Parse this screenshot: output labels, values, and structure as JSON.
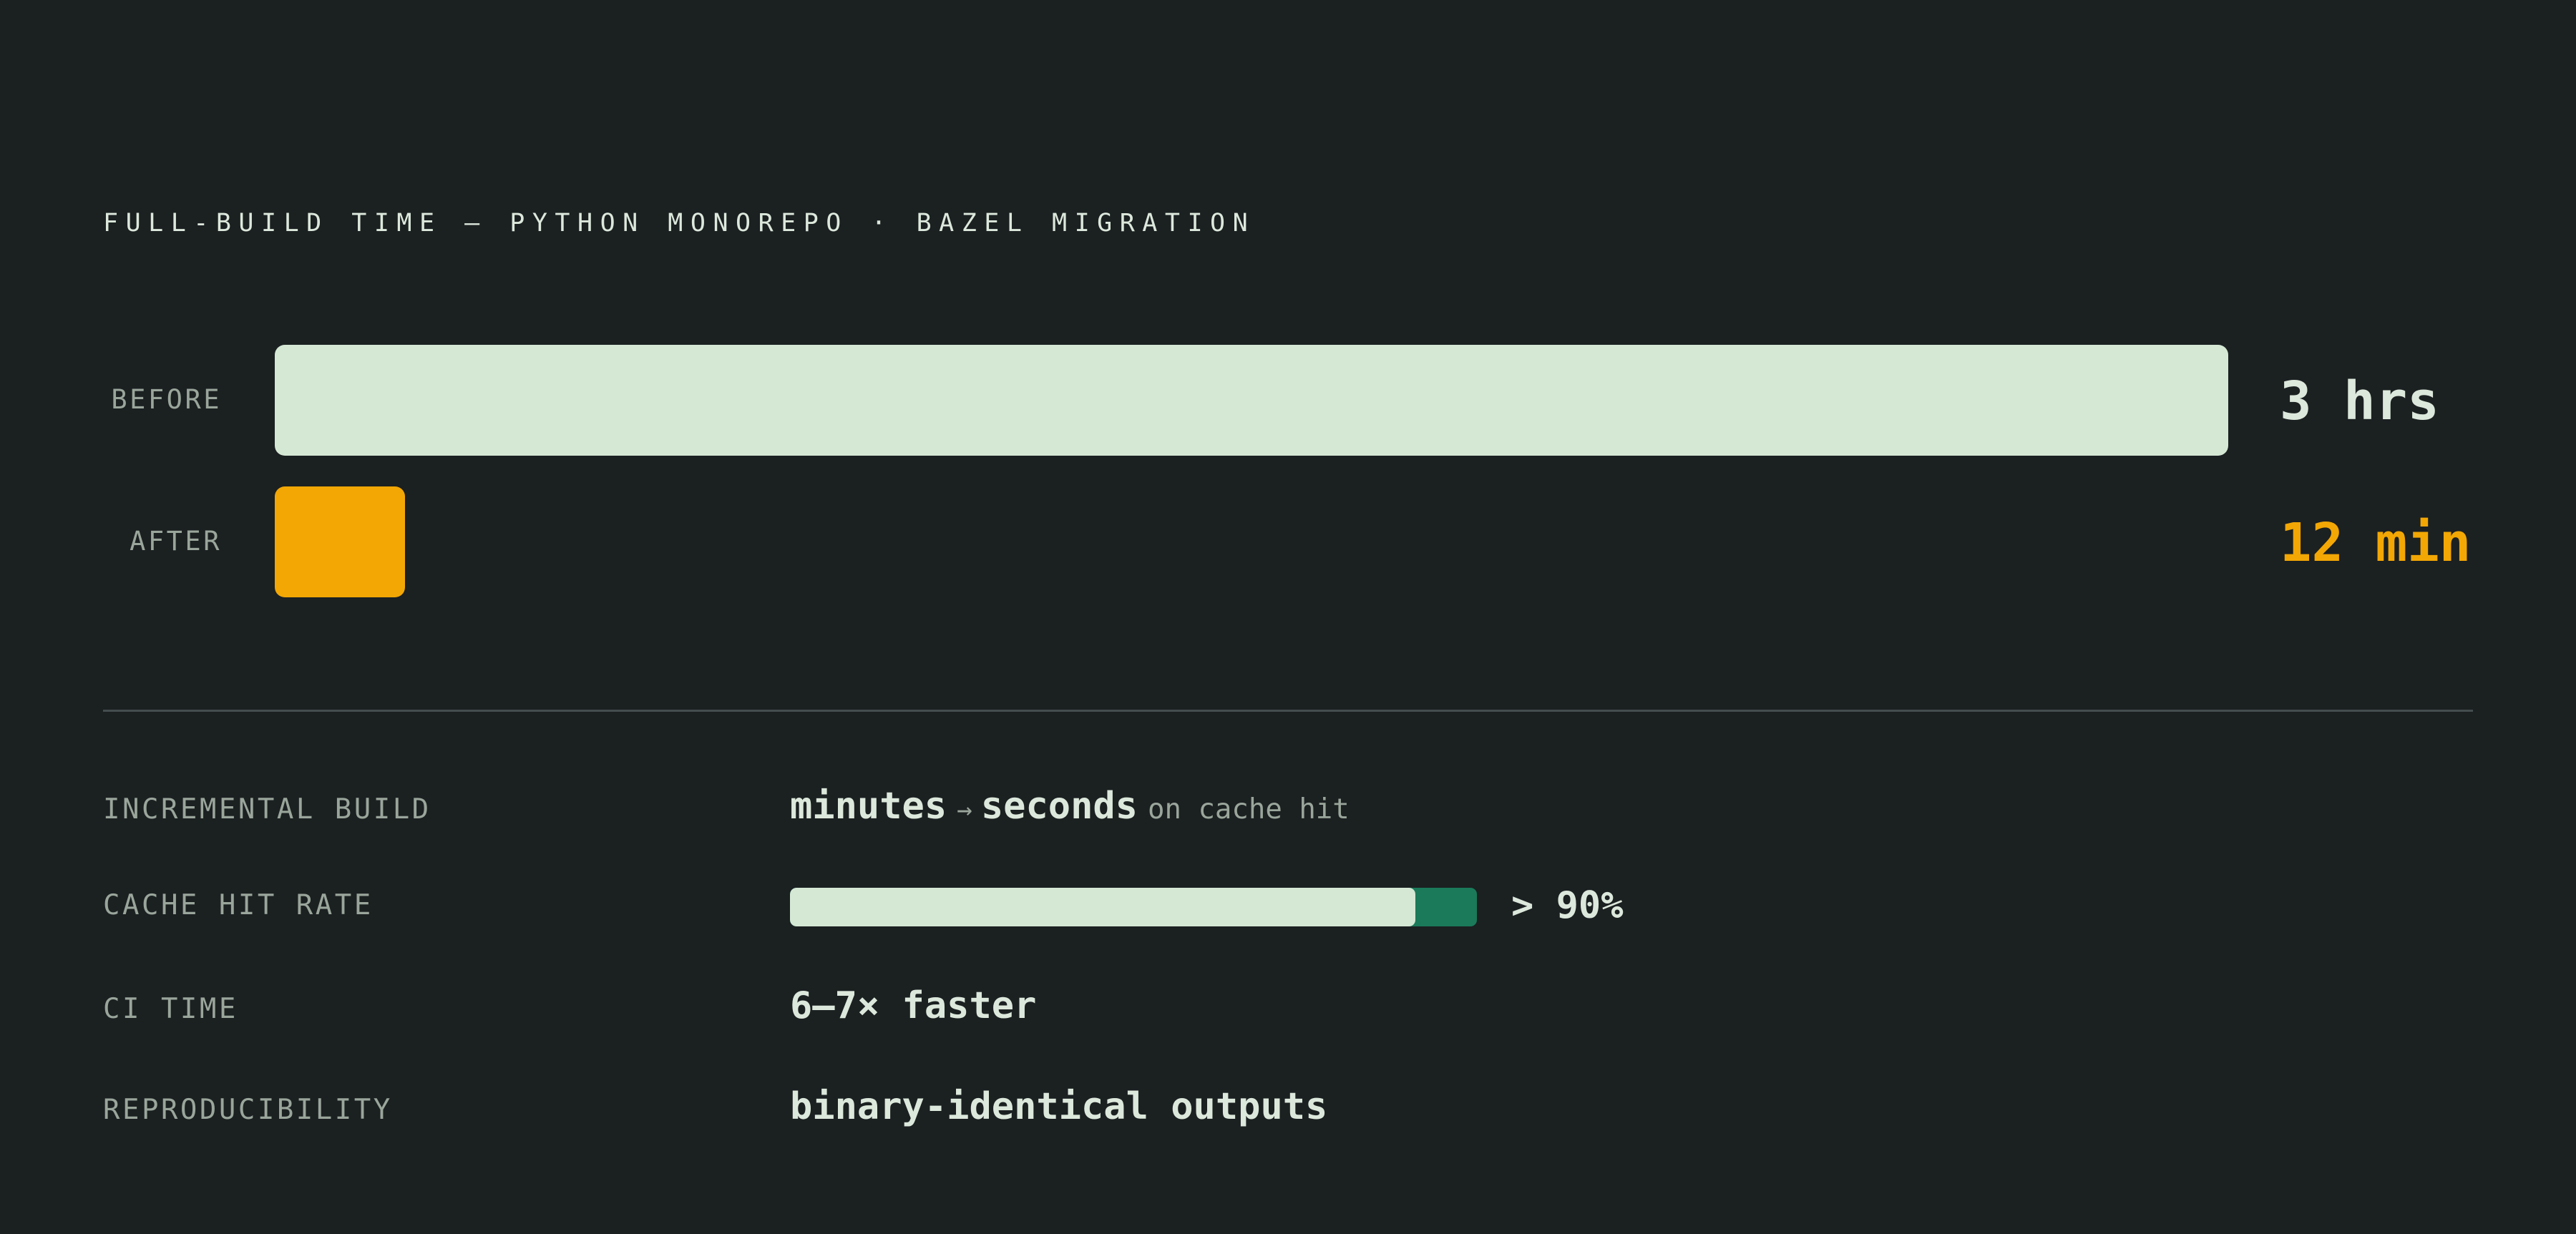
{
  "title": "FULL-BUILD TIME — PYTHON MONOREPO · BAZEL MIGRATION",
  "colors": {
    "background": "#1b2021",
    "before": "#d5e8d4",
    "after": "#f2a705",
    "cache_track": "#1a7a5a"
  },
  "chart_data": {
    "type": "bar",
    "orientation": "horizontal",
    "title": "FULL-BUILD TIME — PYTHON MONOREPO · BAZEL MIGRATION",
    "categories": [
      "BEFORE",
      "AFTER"
    ],
    "values": [
      180,
      12
    ],
    "unit": "min",
    "value_labels": [
      "3 hrs",
      "12 min"
    ],
    "colors": [
      "#d5e8d4",
      "#f2a705"
    ],
    "grid": false
  },
  "stats": {
    "incremental": {
      "label": "INCREMENTAL BUILD",
      "from": "minutes",
      "arrow": "→",
      "to": "seconds",
      "suffix": "on cache hit"
    },
    "cache": {
      "label": "CACHE HIT RATE",
      "value_text": "> 90%",
      "fill_fraction": 0.91
    },
    "ci": {
      "label": "CI TIME",
      "value": "6–7× faster"
    },
    "repro": {
      "label": "REPRODUCIBILITY",
      "value": "binary-identical outputs"
    }
  }
}
